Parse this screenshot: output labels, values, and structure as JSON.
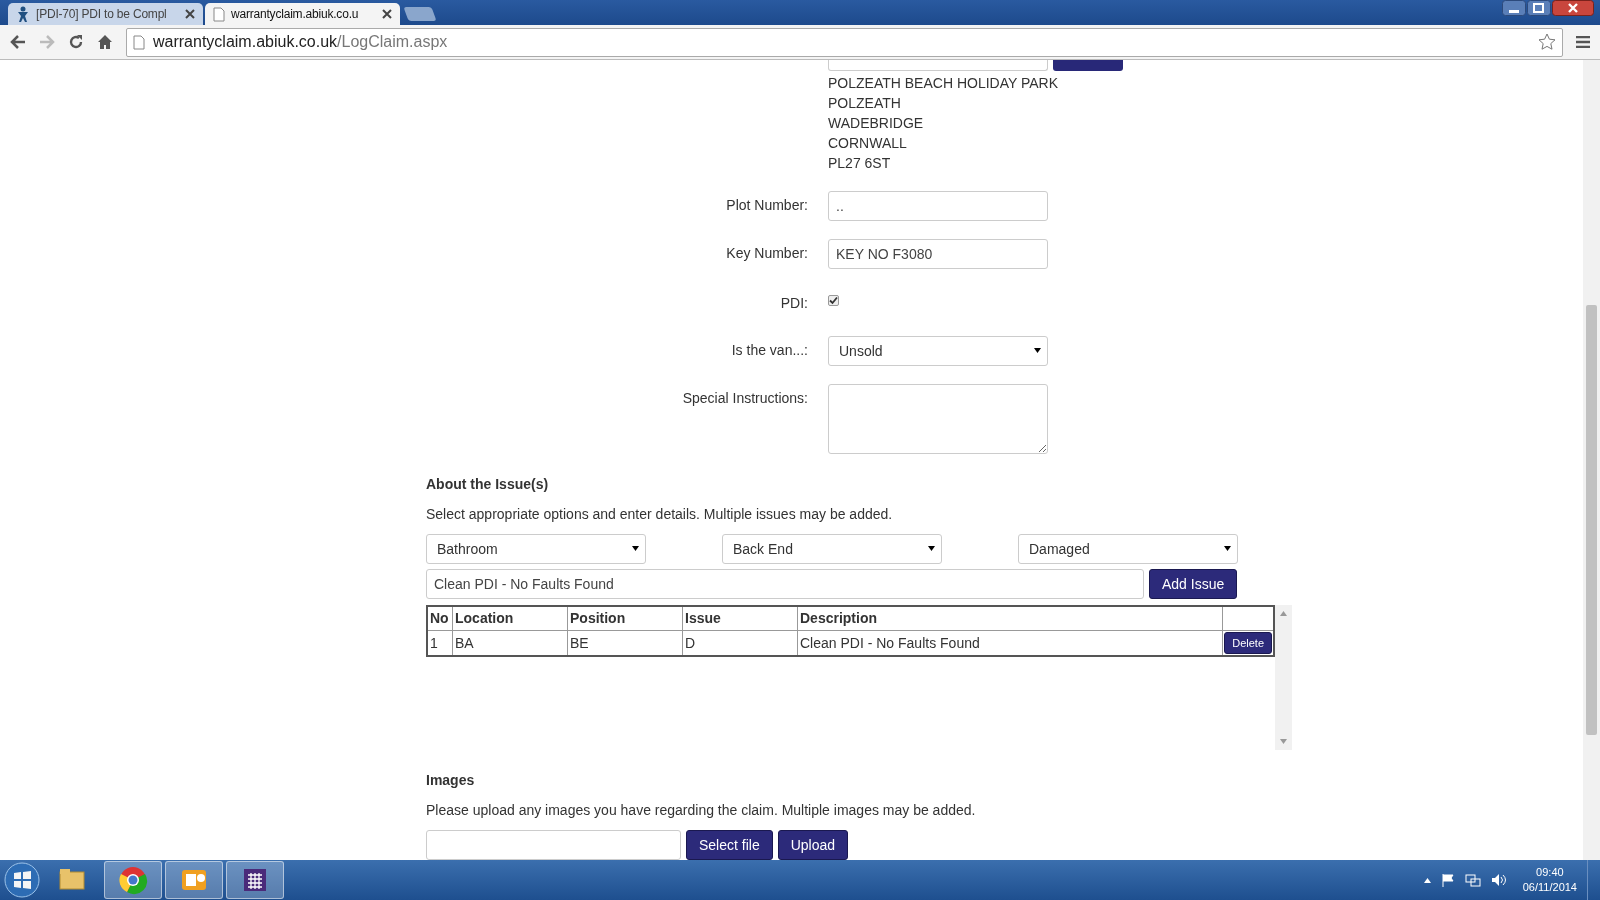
{
  "browser": {
    "tabs": [
      {
        "title": "[PDI-70] PDI to be Compl",
        "selected": false,
        "kind": "jira"
      },
      {
        "title": "warrantyclaim.abiuk.co.u",
        "selected": true,
        "kind": "page"
      }
    ],
    "address": {
      "host": "warrantyclaim.abiuk.co.uk",
      "path": "/LogClaim.aspx"
    }
  },
  "form": {
    "site_address": [
      "POLZEATH BEACH HOLIDAY PARK",
      "POLZEATH",
      "WADEBRIDGE",
      "CORNWALL",
      "PL27 6ST"
    ],
    "fields": [
      {
        "label": "Plot Number:",
        "kind": "text",
        "value": ".."
      },
      {
        "label": "Key Number:",
        "kind": "text",
        "value": "KEY NO F3080"
      },
      {
        "label": "PDI:",
        "kind": "checkbox",
        "checked": true
      },
      {
        "label": "Is the van...:",
        "kind": "select",
        "value": "Unsold"
      },
      {
        "label": "Special Instructions:",
        "kind": "textarea"
      }
    ]
  },
  "issues": {
    "heading": "About the Issue(s)",
    "instructions": "Select appropriate options and enter details. Multiple issues may be added.",
    "selects": [
      "Bathroom",
      "Back End",
      "Damaged"
    ],
    "description": "Clean PDI - No Faults Found",
    "add_button": "Add Issue",
    "table": {
      "columns": [
        "No",
        "Location",
        "Position",
        "Issue",
        "Description"
      ],
      "rows": [
        {
          "cells": [
            "1",
            "BA",
            "BE",
            "D",
            "Clean PDI - No Faults Found"
          ],
          "action": "Delete"
        }
      ]
    }
  },
  "images": {
    "heading": "Images",
    "instructions": "Please upload any images you have regarding the claim. Multiple images may be added.",
    "buttons": [
      "Select file",
      "Upload"
    ]
  },
  "taskbar": {
    "time": "09:40",
    "date": "06/11/2014"
  }
}
